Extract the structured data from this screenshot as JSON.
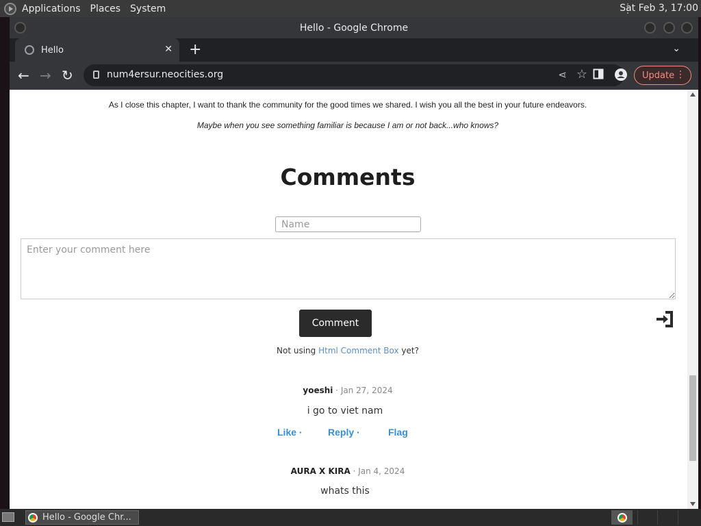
{
  "top_panel": {
    "menus": [
      "Applications",
      "Places",
      "System"
    ],
    "clock": "Sat Feb  3, 17:00"
  },
  "window": {
    "title": "Hello - Google Chrome",
    "tab_title": "Hello",
    "url": "num4ersur.neocities.org",
    "update_label": "Update"
  },
  "page": {
    "farewell_text": "As I close this chapter, I want to thank the community for the good times we shared. I wish you all the best in your future endeavors.",
    "italic_text": "Maybe when you see something familiar is because I am or not back...who knows?",
    "comments_heading": "Comments",
    "name_placeholder": "Name",
    "comment_placeholder": "Enter your comment here",
    "comment_button": "Comment",
    "not_using_prefix": "Not using ",
    "not_using_link": "Html Comment Box",
    "not_using_suffix": "  yet?",
    "comments": [
      {
        "author": "yoeshi",
        "date": " · Jan 27, 2024",
        "body": "i go to viet nam",
        "actions": [
          "Like ·",
          "Reply ·",
          "Flag"
        ]
      },
      {
        "author": "AURA X KIRA",
        "date": " · Jan 4, 2024",
        "body": "whats this"
      }
    ]
  },
  "taskbar": {
    "task_label": "Hello - Google Chr..."
  },
  "colors": {
    "link_blue": "#3a8fd0",
    "update_red": "#f28b82",
    "button_dark": "#2b2b2b"
  }
}
